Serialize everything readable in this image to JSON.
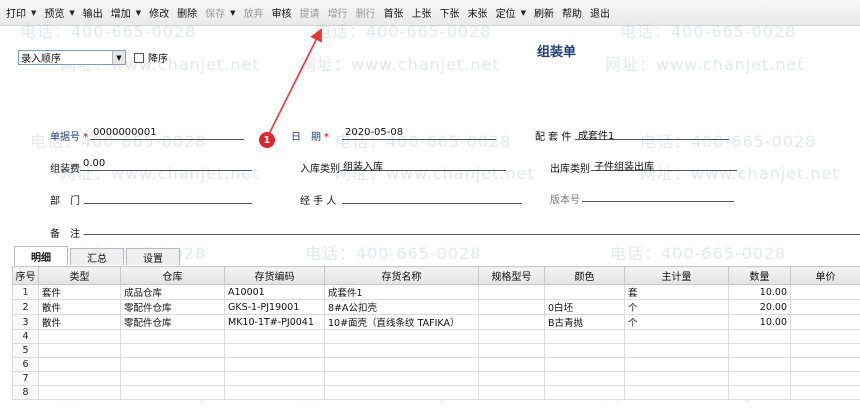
{
  "toolbar": {
    "items": [
      {
        "label": "打印",
        "dropdown": true,
        "disabled": false
      },
      {
        "label": "预览",
        "dropdown": true,
        "disabled": false
      },
      {
        "label": "输出",
        "dropdown": false,
        "disabled": false
      },
      {
        "label": "增加",
        "dropdown": true,
        "disabled": false
      },
      {
        "label": "修改",
        "dropdown": false,
        "disabled": false
      },
      {
        "label": "删除",
        "dropdown": false,
        "disabled": false
      },
      {
        "label": "保存",
        "dropdown": true,
        "disabled": true
      },
      {
        "label": "放弃",
        "dropdown": false,
        "disabled": true
      },
      {
        "label": "审核",
        "dropdown": false,
        "disabled": false
      },
      {
        "label": "提请",
        "dropdown": false,
        "disabled": true
      },
      {
        "label": "增行",
        "dropdown": false,
        "disabled": true
      },
      {
        "label": "删行",
        "dropdown": false,
        "disabled": true
      },
      {
        "label": "首张",
        "dropdown": false,
        "disabled": false
      },
      {
        "label": "上张",
        "dropdown": false,
        "disabled": false
      },
      {
        "label": "下张",
        "dropdown": false,
        "disabled": false
      },
      {
        "label": "末张",
        "dropdown": false,
        "disabled": false
      },
      {
        "label": "定位",
        "dropdown": true,
        "disabled": false
      },
      {
        "label": "刷新",
        "dropdown": false,
        "disabled": false
      },
      {
        "label": "帮助",
        "dropdown": false,
        "disabled": false
      },
      {
        "label": "退出",
        "dropdown": false,
        "disabled": false
      }
    ]
  },
  "sort": {
    "selected": "录入顺序",
    "desc_label": "降序"
  },
  "form": {
    "title": "组装单",
    "doc_no_label": "单据号",
    "doc_no": "0000000001",
    "date_label": "日　期",
    "date": "2020-05-08",
    "kit_label": "配 套 件",
    "kit": "成套件1",
    "fee_label": "组装费",
    "fee": "0.00",
    "in_type_label": "入库类别",
    "in_type": "组装入库",
    "out_type_label": "出库类别",
    "out_type": "子件组装出库",
    "dept_label": "部　门",
    "dept": "",
    "handler_label": "经 手 人",
    "handler": "",
    "version_label": "版本号",
    "version": "",
    "note_label": "备　注",
    "note": ""
  },
  "annotation": {
    "badge": "1"
  },
  "watermarks": {
    "phone": "电话：400-665-0028",
    "site": "网址：www.chanjet.net"
  },
  "tabs": [
    {
      "label": "明细",
      "active": true
    },
    {
      "label": "汇总",
      "active": false
    },
    {
      "label": "设置",
      "active": false
    }
  ],
  "grid": {
    "columns": [
      "序号",
      "类型",
      "仓库",
      "存货编码",
      "存货名称",
      "规格型号",
      "颜色",
      "主计量",
      "数量",
      "单价"
    ],
    "rows": [
      {
        "n": "1",
        "type": "套件",
        "wh": "成品仓库",
        "code": "A10001",
        "name": "成套件1",
        "spec": "",
        "color": "",
        "unit": "套",
        "qty": "10.00",
        "price": ""
      },
      {
        "n": "2",
        "type": "散件",
        "wh": "零配件仓库",
        "code": "GKS-1-PJ19001",
        "name": "8#A公扣壳",
        "spec": "",
        "color": "0白坯",
        "unit": "个",
        "qty": "20.00",
        "price": ""
      },
      {
        "n": "3",
        "type": "散件",
        "wh": "零配件仓库",
        "code": "MK10-1T#-PJ0041",
        "name": "10#面壳（直线条纹 TAFIKA）",
        "spec": "",
        "color": "B古青抛",
        "unit": "个",
        "qty": "10.00",
        "price": ""
      },
      {
        "n": "4",
        "type": "",
        "wh": "",
        "code": "",
        "name": "",
        "spec": "",
        "color": "",
        "unit": "",
        "qty": "",
        "price": ""
      },
      {
        "n": "5",
        "type": "",
        "wh": "",
        "code": "",
        "name": "",
        "spec": "",
        "color": "",
        "unit": "",
        "qty": "",
        "price": ""
      },
      {
        "n": "6",
        "type": "",
        "wh": "",
        "code": "",
        "name": "",
        "spec": "",
        "color": "",
        "unit": "",
        "qty": "",
        "price": ""
      },
      {
        "n": "7",
        "type": "",
        "wh": "",
        "code": "",
        "name": "",
        "spec": "",
        "color": "",
        "unit": "",
        "qty": "",
        "price": ""
      },
      {
        "n": "8",
        "type": "",
        "wh": "",
        "code": "",
        "name": "",
        "spec": "",
        "color": "",
        "unit": "",
        "qty": "",
        "price": ""
      }
    ]
  },
  "colors": {
    "title_blue": "#1f3f7a",
    "badge_red": "#d9272e",
    "arrow_red": "#e23a3a"
  }
}
